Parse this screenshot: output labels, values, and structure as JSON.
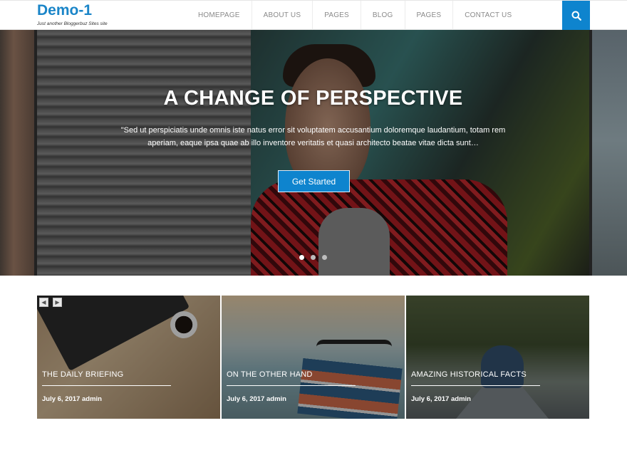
{
  "site": {
    "title": "Demo-1",
    "tagline": "Just another Bloggerbuz Sites site"
  },
  "nav": {
    "items": [
      {
        "label": "HOMEPAGE"
      },
      {
        "label": "ABOUT US"
      },
      {
        "label": "PAGES"
      },
      {
        "label": "BLOG"
      },
      {
        "label": "PAGES"
      },
      {
        "label": "CONTACT US"
      }
    ],
    "search_icon": "search-icon"
  },
  "hero": {
    "title": "A CHANGE OF PERSPECTIVE",
    "text": "\"Sed ut perspiciatis unde omnis iste natus error sit voluptatem accusantium doloremque laudantium, totam rem aperiam, eaque ipsa quae ab illo inventore veritatis et quasi architecto beatae vitae dicta sunt…",
    "button_label": "Get Started",
    "slide_count": 3,
    "active_slide": 1
  },
  "featured": {
    "prev_icon": "chevron-left-icon",
    "next_icon": "chevron-right-icon",
    "cards": [
      {
        "title": "THE DAILY BRIEFING",
        "meta": "July 6, 2017 admin"
      },
      {
        "title": "ON THE OTHER HAND",
        "meta": "July 6, 2017 admin"
      },
      {
        "title": "AMAZING HISTORICAL FACTS",
        "meta": "July 6, 2017 admin"
      }
    ]
  },
  "colors": {
    "accent": "#0e84ce",
    "brand": "#1a85c8"
  }
}
